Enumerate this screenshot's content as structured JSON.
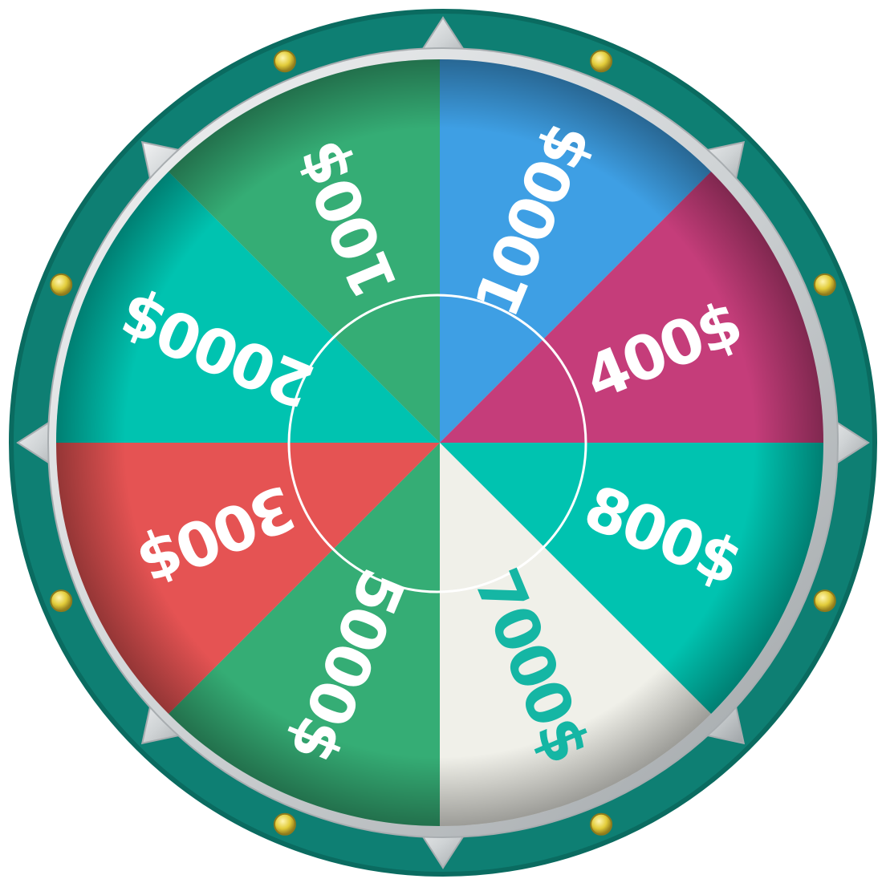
{
  "wheel": {
    "colors": {
      "outer_ring": "#0e7f73",
      "outer_ring_edge": "#0a6b60",
      "silver": "#d9dcdd",
      "silver_dark": "#a8adb0",
      "bolt": "#e2cc3a",
      "bolt_edge": "#8d7a1c",
      "inner_circle_stroke": "#ffffff"
    },
    "segments": [
      {
        "label": "1000$",
        "color": "#3e9fe4",
        "text_color": "#ffffff",
        "name": "segment-1000"
      },
      {
        "label": "400$",
        "color": "#c53d7a",
        "text_color": "#ffffff",
        "name": "segment-400"
      },
      {
        "label": "800$",
        "color": "#00c3b0",
        "text_color": "#ffffff",
        "name": "segment-800"
      },
      {
        "label": "7000$",
        "color": "#f0f0e9",
        "text_color": "#15b6a4",
        "name": "segment-7000"
      },
      {
        "label": "5000$",
        "color": "#35ad75",
        "text_color": "#ffffff",
        "name": "segment-5000"
      },
      {
        "label": "300$",
        "color": "#e55353",
        "text_color": "#ffffff",
        "name": "segment-300"
      },
      {
        "label": "2000$",
        "color": "#00c3b0",
        "text_color": "#ffffff",
        "name": "segment-2000"
      },
      {
        "label": "100$",
        "color": "#35ad75",
        "text_color": "#ffffff",
        "name": "segment-100"
      }
    ],
    "spikes": 8,
    "bolts": 8
  }
}
